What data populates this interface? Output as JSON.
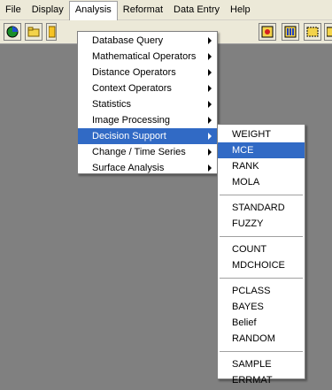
{
  "menubar": {
    "items": [
      "File",
      "Display",
      "Analysis",
      "Reformat",
      "Data Entry",
      "Help"
    ]
  },
  "analysis_menu": {
    "items": [
      "Database Query",
      "Mathematical Operators",
      "Distance Operators",
      "Context Operators",
      "Statistics",
      "Image Processing",
      "Decision Support",
      "Change / Time Series",
      "Surface Analysis"
    ]
  },
  "decision_menu": {
    "group1": [
      "WEIGHT",
      "MCE",
      "RANK",
      "MOLA"
    ],
    "group2": [
      "STANDARD",
      "FUZZY"
    ],
    "group3": [
      "COUNT",
      "MDCHOICE"
    ],
    "group4": [
      "PCLASS",
      "BAYES",
      "Belief",
      "RANDOM"
    ],
    "group5": [
      "SAMPLE",
      "ERRMAT"
    ]
  },
  "colors": {
    "menu_highlight": "#316ac5",
    "workspace": "#808080",
    "chrome": "#ece9d8"
  },
  "icons": [
    "globe-icon",
    "folder-open-icon",
    "document-icon",
    "composer-icon",
    "legend-icon",
    "layer-icon",
    "map-icon"
  ]
}
